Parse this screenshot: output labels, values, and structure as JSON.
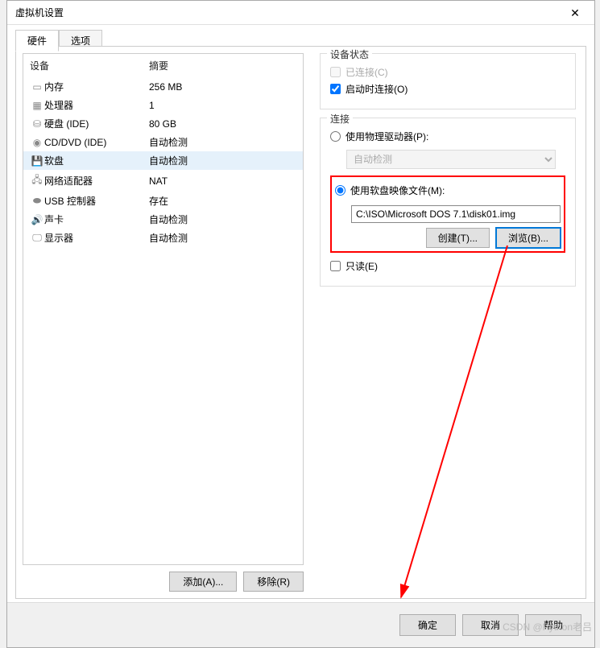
{
  "window": {
    "title": "虚拟机设置",
    "close": "✕"
  },
  "tabs": {
    "hardware": "硬件",
    "options": "选项"
  },
  "hw_header": {
    "device": "设备",
    "summary": "摘要"
  },
  "hw": [
    {
      "icon": "▭",
      "name": "内存",
      "summary": "256 MB"
    },
    {
      "icon": "▦",
      "name": "处理器",
      "summary": "1"
    },
    {
      "icon": "⛁",
      "name": "硬盘 (IDE)",
      "summary": "80 GB"
    },
    {
      "icon": "◉",
      "name": "CD/DVD (IDE)",
      "summary": "自动检测"
    },
    {
      "icon": "💾",
      "name": "软盘",
      "summary": "自动检测",
      "sel": true
    },
    {
      "icon": "🖧",
      "name": "网络适配器",
      "summary": "NAT"
    },
    {
      "icon": "⬬",
      "name": "USB 控制器",
      "summary": "存在"
    },
    {
      "icon": "🔊",
      "name": "声卡",
      "summary": "自动检测"
    },
    {
      "icon": "🖵",
      "name": "显示器",
      "summary": "自动检测"
    }
  ],
  "hw_btns": {
    "add": "添加(A)...",
    "remove": "移除(R)"
  },
  "status": {
    "title": "设备状态",
    "connected": "已连接(C)",
    "connect_on": "启动时连接(O)"
  },
  "conn": {
    "title": "连接",
    "physical": "使用物理驱动器(P):",
    "phys_sel": "自动检测",
    "image": "使用软盘映像文件(M):",
    "path": "C:\\ISO\\Microsoft DOS 7.1\\disk01.img",
    "create": "创建(T)...",
    "browse": "浏览(B)...",
    "readonly": "只读(E)"
  },
  "footer": {
    "ok": "确定",
    "cancel": "取消",
    "help": "帮助"
  },
  "watermark": "CSDN @Python老吕"
}
